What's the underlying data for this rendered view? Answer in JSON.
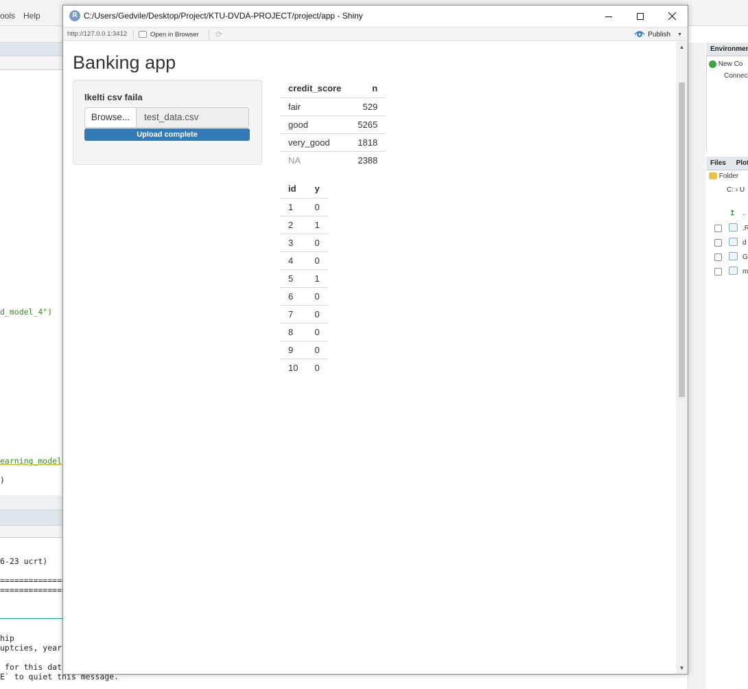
{
  "background": {
    "menus": [
      "ools",
      "Help"
    ],
    "code_lines": [
      {
        "text": "d_model_4\")",
        "color": "green"
      },
      {
        "text": "earning_model",
        "color": "green"
      },
      {
        "text": ")",
        "color": "plain"
      },
      {
        "text": "6-23 ucrt)",
        "color": "plain"
      },
      {
        "text": "==============",
        "color": "plain"
      },
      {
        "text": "==============",
        "color": "plain"
      },
      {
        "text": "hip",
        "color": "plain"
      },
      {
        "text": "uptcies, year",
        "color": "plain"
      },
      {
        "text": " for this dat",
        "color": "plain"
      },
      {
        "text": "E` to quiet this message.",
        "color": "plain"
      }
    ],
    "right_panel": {
      "environment_tab": "Environmen",
      "new_connection": "New Co",
      "connections": "Connect",
      "files_tab": "Files",
      "plots_tab": "Plot",
      "folder_button": "Folder",
      "path_start": "C:",
      "path_next": "U",
      "up_dir": "..",
      "file_rows": [
        ".R",
        "d",
        "G",
        "m"
      ]
    }
  },
  "window": {
    "title": "C:/Users/Gedvile/Desktop/Project/KTU-DVDA-PROJECT/project/app - Shiny",
    "logo": "R"
  },
  "toolbar": {
    "url": "http://127.0.0.1:3412",
    "open_in_browser": "Open in Browser",
    "publish": "Publish"
  },
  "app": {
    "title": "Banking app",
    "file_input": {
      "label": "Ikelti csv faila",
      "browse_label": "Browse...",
      "file_name": "test_data.csv",
      "progress_text": "Upload complete",
      "progress_fraction": 1.0
    },
    "credit_table": {
      "headers": [
        "credit_score",
        "n"
      ],
      "rows": [
        [
          "fair",
          "529"
        ],
        [
          "good",
          "5265"
        ],
        [
          "very_good",
          "1818"
        ],
        [
          "NA",
          "2388"
        ]
      ]
    },
    "id_table": {
      "headers": [
        "id",
        "y"
      ],
      "rows": [
        [
          "1",
          "0"
        ],
        [
          "2",
          "1"
        ],
        [
          "3",
          "0"
        ],
        [
          "4",
          "0"
        ],
        [
          "5",
          "1"
        ],
        [
          "6",
          "0"
        ],
        [
          "7",
          "0"
        ],
        [
          "8",
          "0"
        ],
        [
          "9",
          "0"
        ],
        [
          "10",
          "0"
        ]
      ]
    }
  },
  "colors": {
    "accent": "#337ab7",
    "well": "#f5f5f5",
    "text": "#333333"
  }
}
